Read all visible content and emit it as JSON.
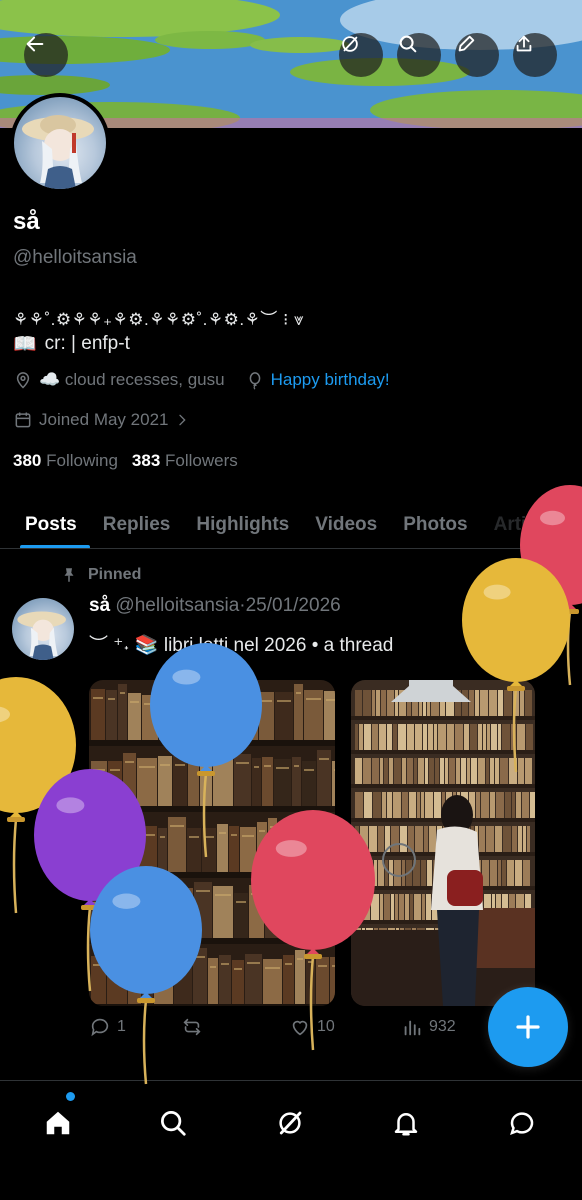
{
  "profile": {
    "name": "så",
    "handle": "@helloitsansia",
    "bio_line1": "⚘⚘˚.⚙⚘⚘₊⚘⚙.⚘⚘⚙˚.⚘⚙.⚘︶ ⁝ ⩔",
    "bio_emoji": "📖",
    "bio_line2": "cr: | enfp-t",
    "location": "☁️ cloud recesses, gusu",
    "birthday_link": "Happy birthday!",
    "joined": "Joined May 2021",
    "following_count": "380",
    "following_label": "Following",
    "followers_count": "383",
    "followers_label": "Followers"
  },
  "tabs": [
    {
      "label": "Posts"
    },
    {
      "label": "Replies"
    },
    {
      "label": "Highlights"
    },
    {
      "label": "Videos"
    },
    {
      "label": "Photos"
    },
    {
      "label": "Articles"
    }
  ],
  "post": {
    "pinned_label": "Pinned",
    "author_name": "så",
    "author_handle": "@helloitsansia",
    "separator": "·",
    "date": "25/01/2026",
    "text": "︶ ⁺˖ 📚 libri letti nel 2026 • a thread",
    "replies": "1",
    "retweets": "",
    "likes": "10",
    "views": "932"
  },
  "icons": {
    "back": "back-arrow-icon",
    "grok": "grok-icon",
    "search": "search-icon",
    "edit": "pencil-icon",
    "share": "share-icon",
    "location": "location-pin-icon",
    "birthday": "balloon-icon",
    "calendar": "calendar-icon",
    "pin": "pin-icon"
  },
  "colors": {
    "accent": "#1d9bf0",
    "muted": "#71767b",
    "background": "#000000",
    "balloon_red": "#e0475e",
    "balloon_yellow": "#e6b83a",
    "balloon_blue": "#4a90e2",
    "balloon_purple": "#8a3fd1"
  }
}
